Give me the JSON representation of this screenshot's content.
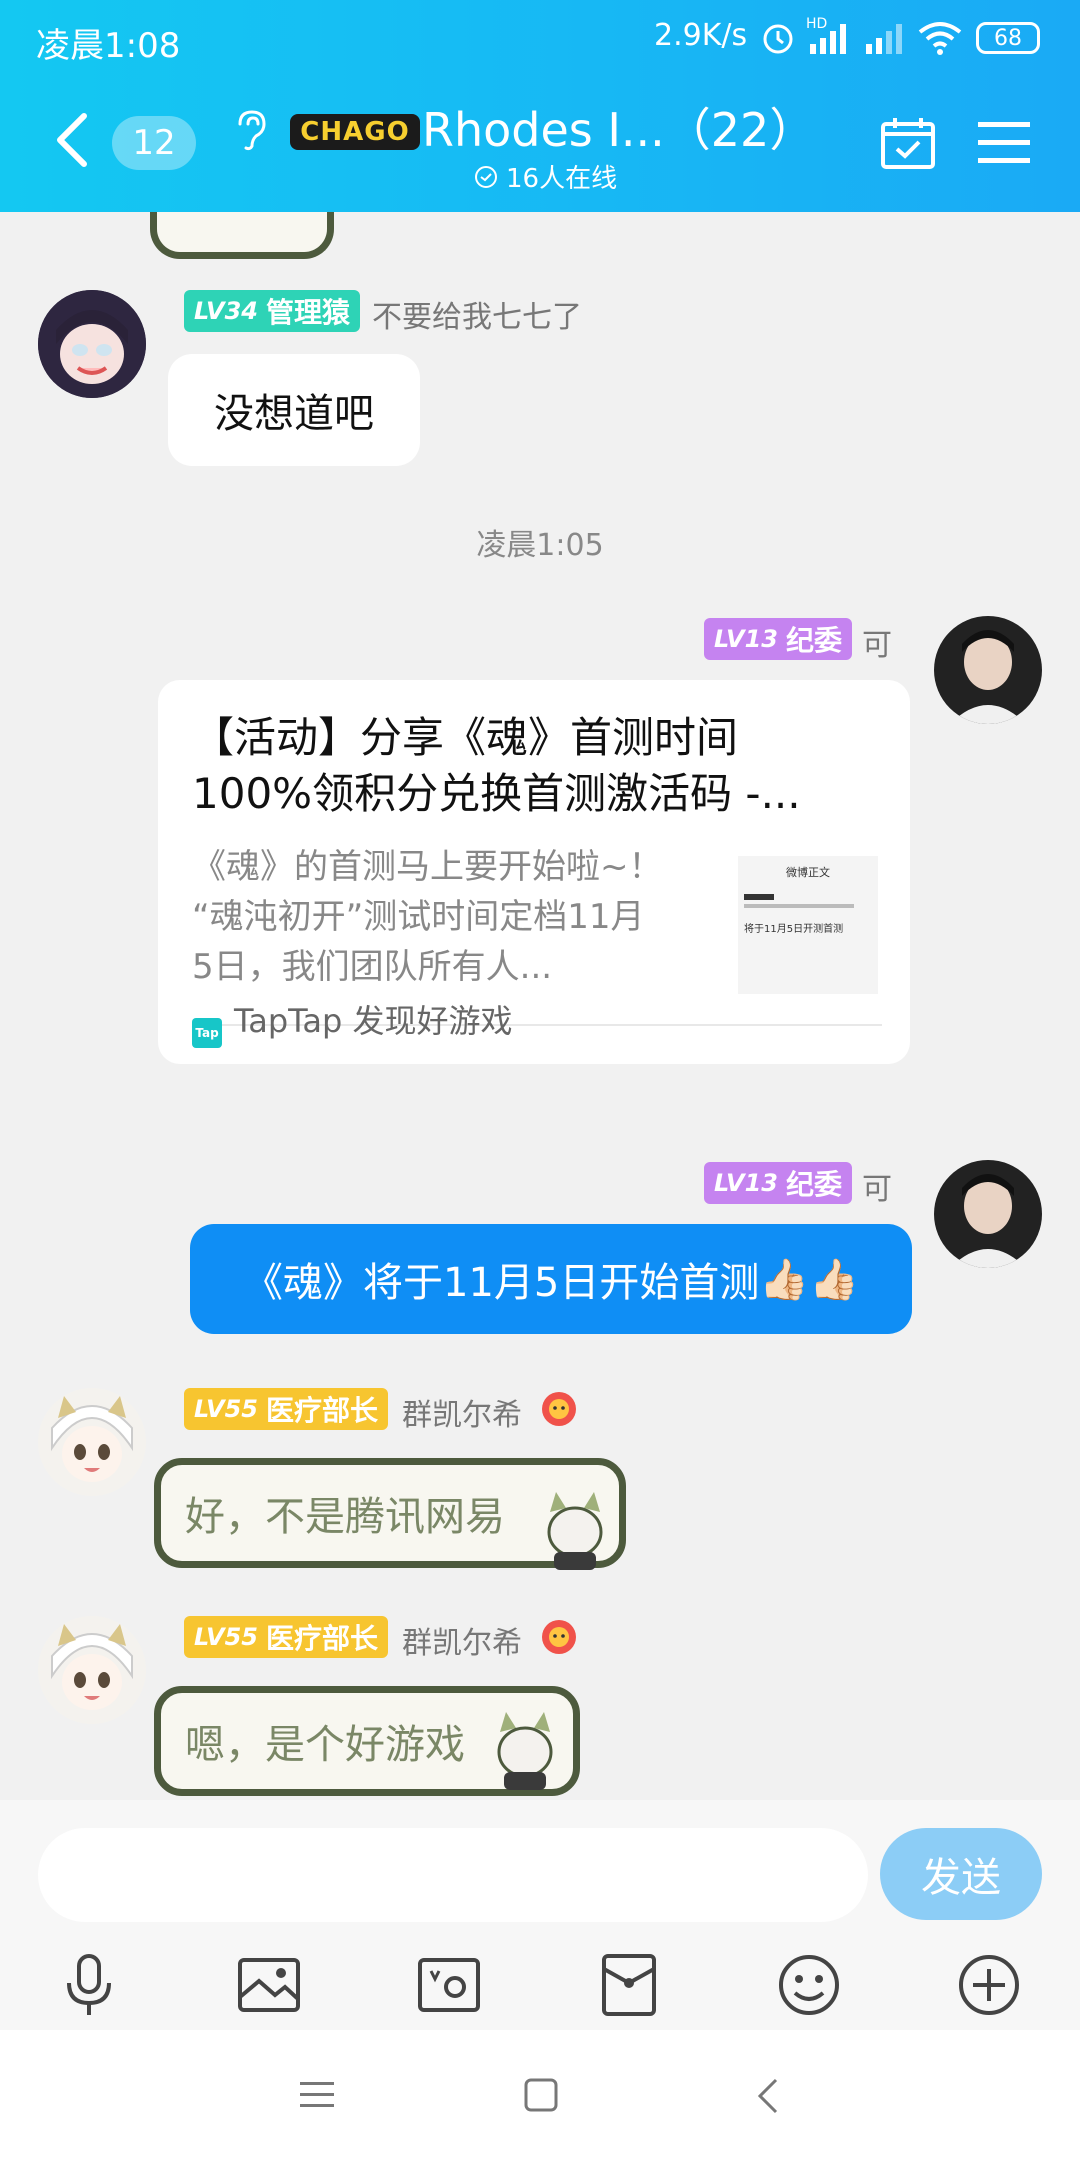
{
  "status_bar": {
    "time": "凌晨1:08",
    "net_speed": "2.9K/s",
    "hd_label": "HD",
    "battery": "68"
  },
  "header": {
    "unread_count": "12",
    "brand": "CHAGO",
    "title": "Rhodes I...（22）",
    "online": "16人在线"
  },
  "messages": [
    {
      "level": "LV34",
      "role": "管理猿",
      "nick": "不要给我七七了",
      "text": "没想道吧"
    },
    {
      "timestamp": "凌晨1:05"
    },
    {
      "level": "LV13",
      "role": "纪委",
      "nick": "可",
      "card": {
        "title": "【活动】分享《魂》首测时间100%领积分兑换首测激活码 -...",
        "title_line1": "【活动】分享《魂》首测时间",
        "title_line2": "100%领积分兑换首测激活码 -...",
        "desc_line1": "《魂》的首测马上要开始啦~！",
        "desc_line2": "“魂沌初开”测试时间定档11月",
        "desc_line3": "5日，我们团队所有人...",
        "thumb_caption": "微博正文",
        "thumb_text": "将于11月5日开测首测",
        "source_icon": "Tap",
        "source": "TapTap 发现好游戏"
      }
    },
    {
      "level": "LV13",
      "role": "纪委",
      "nick": "可",
      "text": "《魂》将于11月5日开始首测",
      "emoji": "👍🏻👍🏻"
    },
    {
      "level": "LV55",
      "role": "医疗部长",
      "nick": "群凯尔希",
      "text": "好，不是腾讯网易"
    },
    {
      "level": "LV55",
      "role": "医疗部长",
      "nick": "群凯尔希",
      "text": "嗯，是个好游戏"
    }
  ],
  "input": {
    "placeholder": "",
    "send_label": "发送"
  },
  "colors": {
    "header": "#17b8f4",
    "lv34": "#2ed3b6",
    "lv13": "#c583f0",
    "lv55": "#f7c530",
    "send": "#8ccdf6",
    "blue_bubble": "#0f8ef5"
  }
}
